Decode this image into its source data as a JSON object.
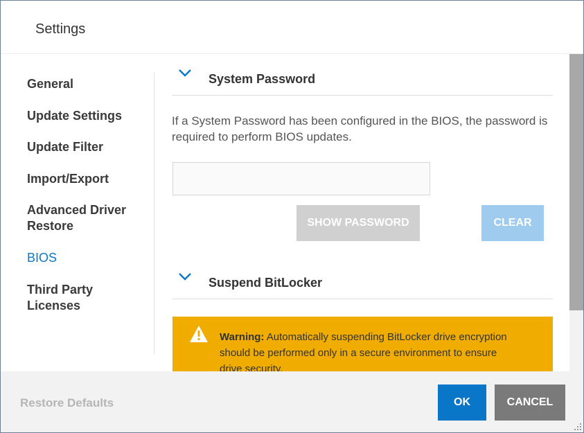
{
  "dialog": {
    "title": "Settings"
  },
  "sidebar": {
    "items": [
      {
        "label": "General"
      },
      {
        "label": "Update Settings"
      },
      {
        "label": "Update Filter"
      },
      {
        "label": "Import/Export"
      },
      {
        "label": "Advanced Driver Restore"
      },
      {
        "label": "BIOS"
      },
      {
        "label": "Third Party Licenses"
      }
    ],
    "active": "BIOS"
  },
  "bios": {
    "system_password": {
      "title": "System Password",
      "description": "If a System Password has been configured in the BIOS, the password is required to perform BIOS updates.",
      "input_value": "",
      "show_button": "SHOW PASSWORD",
      "clear_button": "CLEAR"
    },
    "bitlocker": {
      "title": "Suspend BitLocker",
      "warning_label": "Warning:",
      "warning_text": "Automatically suspending BitLocker drive encryption should be performed only in a secure environment to ensure drive security."
    }
  },
  "footer": {
    "restore_defaults": "Restore Defaults",
    "ok": "OK",
    "cancel": "CANCEL"
  },
  "colors": {
    "accent": "#0a76c8",
    "warning_bg": "#f0ad00",
    "cancel_bg": "#7a7a7a",
    "disabled_button": "#d0d0d0",
    "clear_disabled": "#9fcbee"
  },
  "icons": [
    "chevron-down-icon",
    "warning-icon",
    "resize-grip-icon"
  ]
}
